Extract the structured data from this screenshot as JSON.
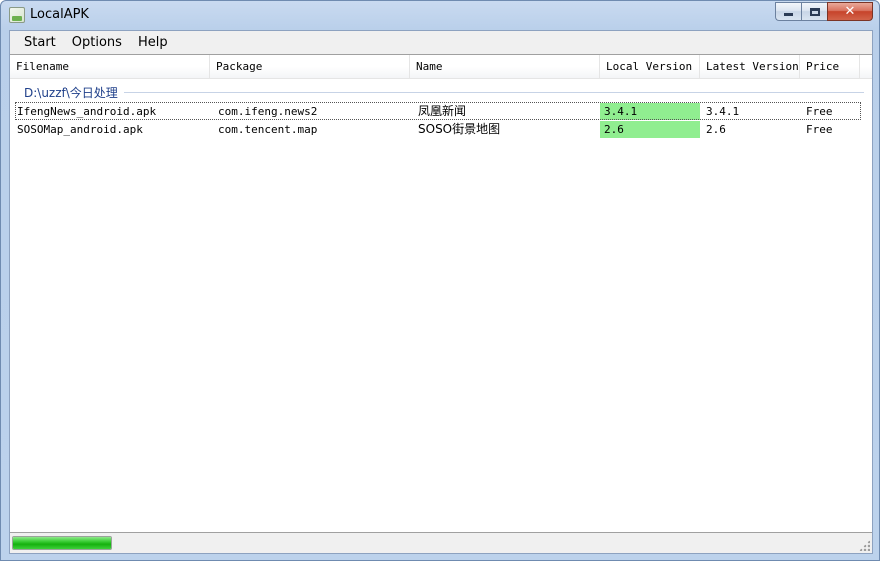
{
  "window": {
    "title": "LocalAPK"
  },
  "menu": {
    "items": [
      "Start",
      "Options",
      "Help"
    ]
  },
  "list": {
    "columns": [
      "Filename",
      "Package",
      "Name",
      "Local Version",
      "Latest Version",
      "Price"
    ],
    "group_label": "D:\\uzzf\\今日处理",
    "rows": [
      {
        "filename": "IfengNews_android.apk",
        "package": "com.ifeng.news2",
        "name": "凤凰新闻",
        "local_version": "3.4.1",
        "latest_version": "3.4.1",
        "price": "Free"
      },
      {
        "filename": "SOSOMap_android.apk",
        "package": "com.tencent.map",
        "name": "SOSO街景地图",
        "local_version": "2.6",
        "latest_version": "2.6",
        "price": "Free"
      }
    ],
    "up_to_date_color": "#90ee90"
  },
  "status": {
    "progress_fraction": 1.0,
    "progress_color": "#16b10f"
  },
  "icons": {
    "app": "apk-app-icon",
    "minimize": "minimize-icon",
    "maximize": "maximize-icon",
    "close": "close-icon",
    "grip": "resize-grip-icon"
  }
}
